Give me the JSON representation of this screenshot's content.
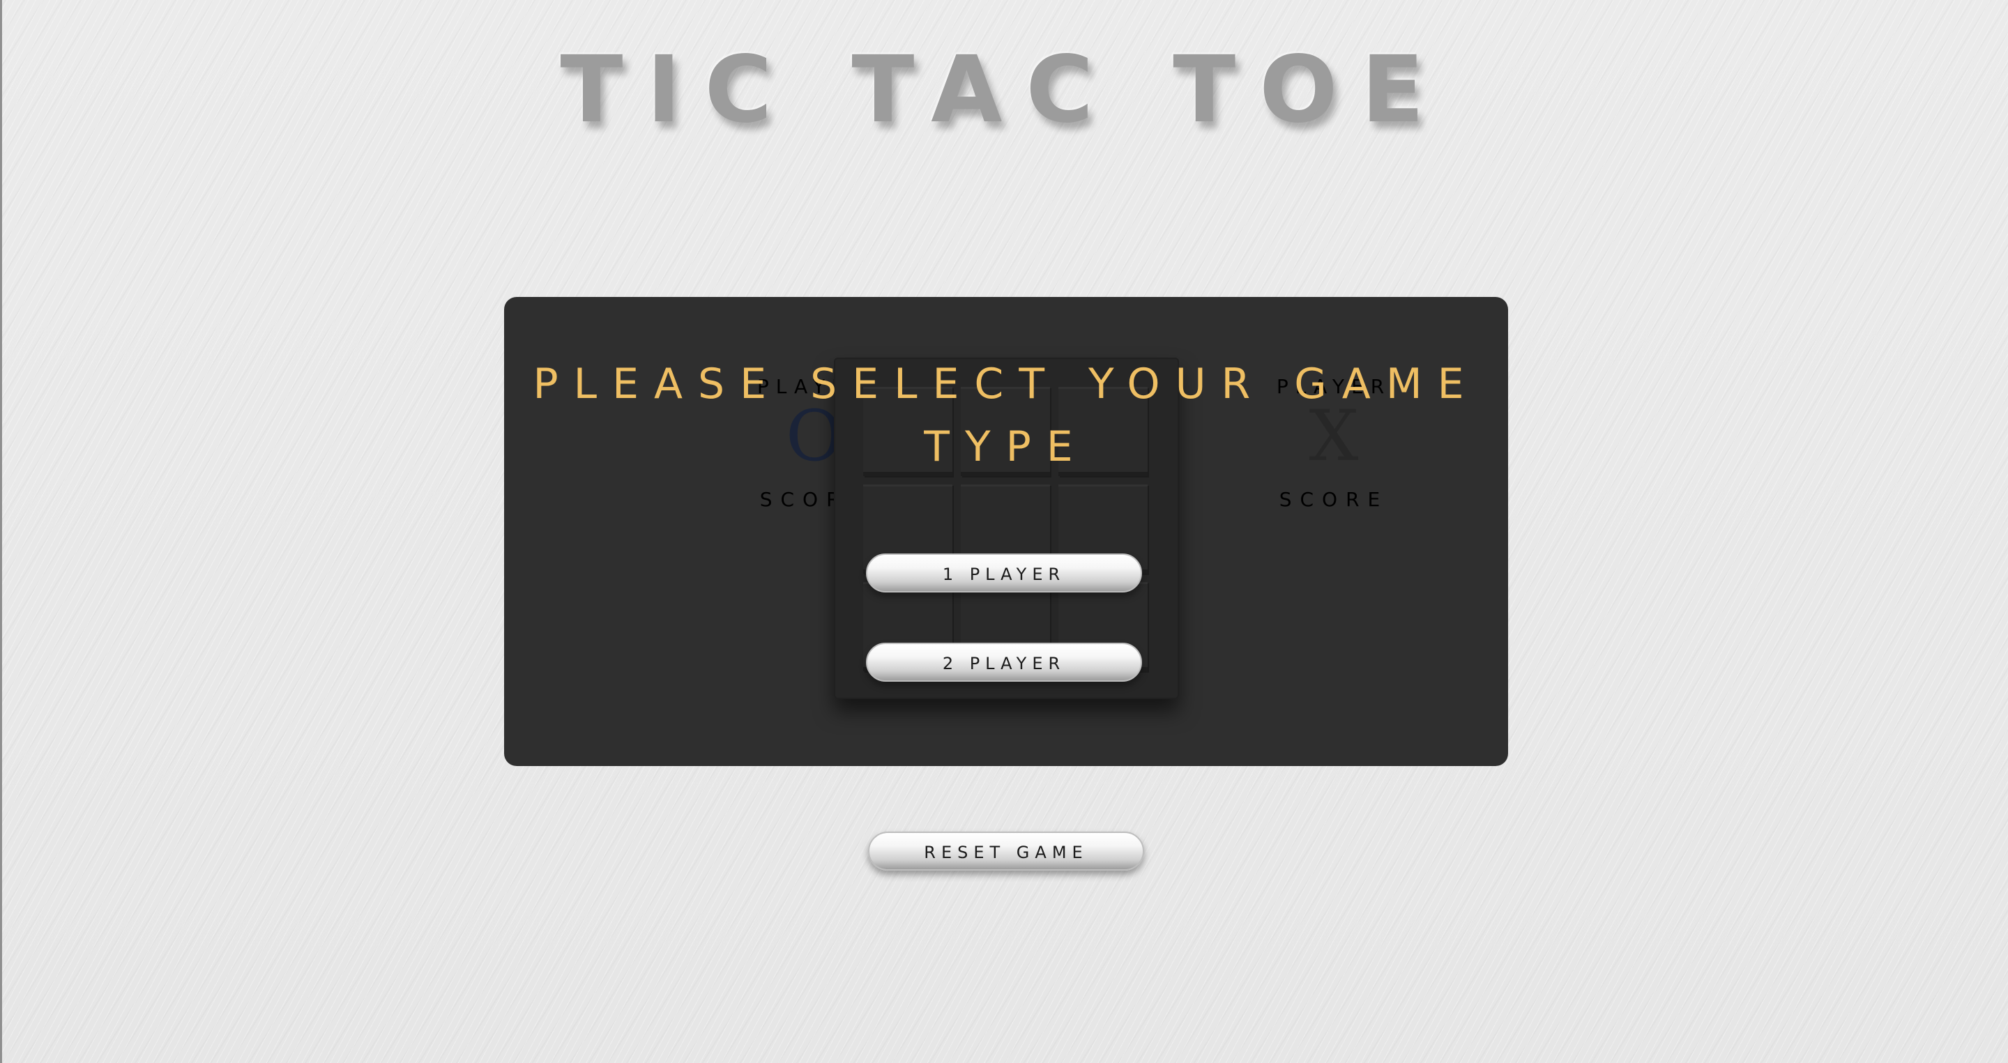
{
  "title": "TIC TAC TOE",
  "players": {
    "left": {
      "label": "PLAYER",
      "mark": "O",
      "score_label": "SCORE"
    },
    "right": {
      "label": "PLAYER",
      "mark": "X",
      "score_label": "SCORE"
    }
  },
  "overlay": {
    "message": "PLEASE SELECT YOUR GAME TYPE",
    "one_player_label": "1 PLAYER",
    "two_player_label": "2 PLAYER"
  },
  "reset_label": "RESET GAME",
  "colors": {
    "accent": "#efbf63",
    "panel": "#2f2f2f",
    "background": "#e7e7e7",
    "mark_o": "#1a2338"
  }
}
